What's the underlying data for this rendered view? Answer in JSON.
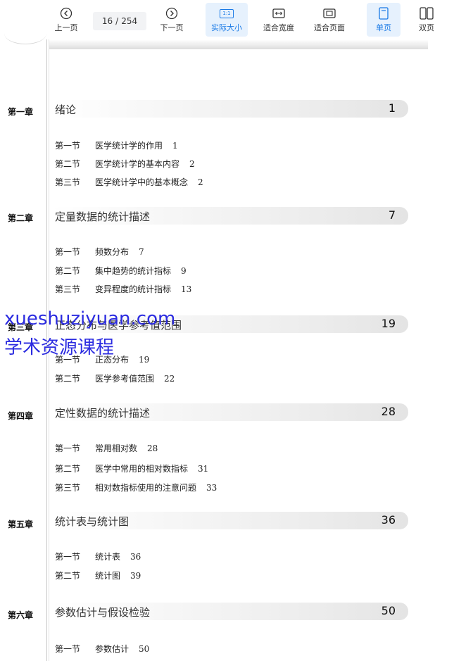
{
  "toolbar": {
    "prev_label": "上一页",
    "next_label": "下一页",
    "current_page": "16",
    "page_separator": "/",
    "total_pages": "254",
    "actual_size_label": "实际大小",
    "actual_size_icon_text": "1:1",
    "fit_width_label": "适合宽度",
    "fit_page_label": "适合页面",
    "single_page_label": "单页",
    "double_page_label": "双页"
  },
  "toc": {
    "chapters": [
      {
        "label": "第一章",
        "title": "绪论",
        "page": "1",
        "sections": [
          {
            "num": "第一节",
            "title": "医学统计学的作用",
            "page": "1"
          },
          {
            "num": "第二节",
            "title": "医学统计学的基本内容",
            "page": "2"
          },
          {
            "num": "第三节",
            "title": "医学统计学中的基本概念",
            "page": "2"
          }
        ]
      },
      {
        "label": "第二章",
        "title": "定量数据的统计描述",
        "page": "7",
        "sections": [
          {
            "num": "第一节",
            "title": "频数分布",
            "page": "7"
          },
          {
            "num": "第二节",
            "title": "集中趋势的统计指标",
            "page": "9"
          },
          {
            "num": "第三节",
            "title": "变异程度的统计指标",
            "page": "13"
          }
        ]
      },
      {
        "label": "第三章",
        "title": "正态分布与医学参考值范围",
        "page": "19",
        "sections": [
          {
            "num": "第一节",
            "title": "正态分布",
            "page": "19"
          },
          {
            "num": "第二节",
            "title": "医学参考值范围",
            "page": "22"
          }
        ]
      },
      {
        "label": "第四章",
        "title": "定性数据的统计描述",
        "page": "28",
        "sections": [
          {
            "num": "第一节",
            "title": "常用相对数",
            "page": "28"
          },
          {
            "num": "第二节",
            "title": "医学中常用的相对数指标",
            "page": "31"
          },
          {
            "num": "第三节",
            "title": "相对数指标使用的注意问题",
            "page": "33"
          }
        ]
      },
      {
        "label": "第五章",
        "title": "统计表与统计图",
        "page": "36",
        "sections": [
          {
            "num": "第一节",
            "title": "统计表",
            "page": "36"
          },
          {
            "num": "第二节",
            "title": "统计图",
            "page": "39"
          }
        ]
      },
      {
        "label": "第六章",
        "title": "参数估计与假设检验",
        "page": "50",
        "sections": [
          {
            "num": "第一节",
            "title": "参数估计",
            "page": "50"
          }
        ]
      }
    ]
  },
  "watermark": {
    "line1": "xueshuziyuan.com",
    "line2": "学术资源课程",
    "color": "#2b2be0"
  },
  "colors": {
    "active_bg": "#e6f1fd",
    "active_text": "#1a7ae6"
  }
}
